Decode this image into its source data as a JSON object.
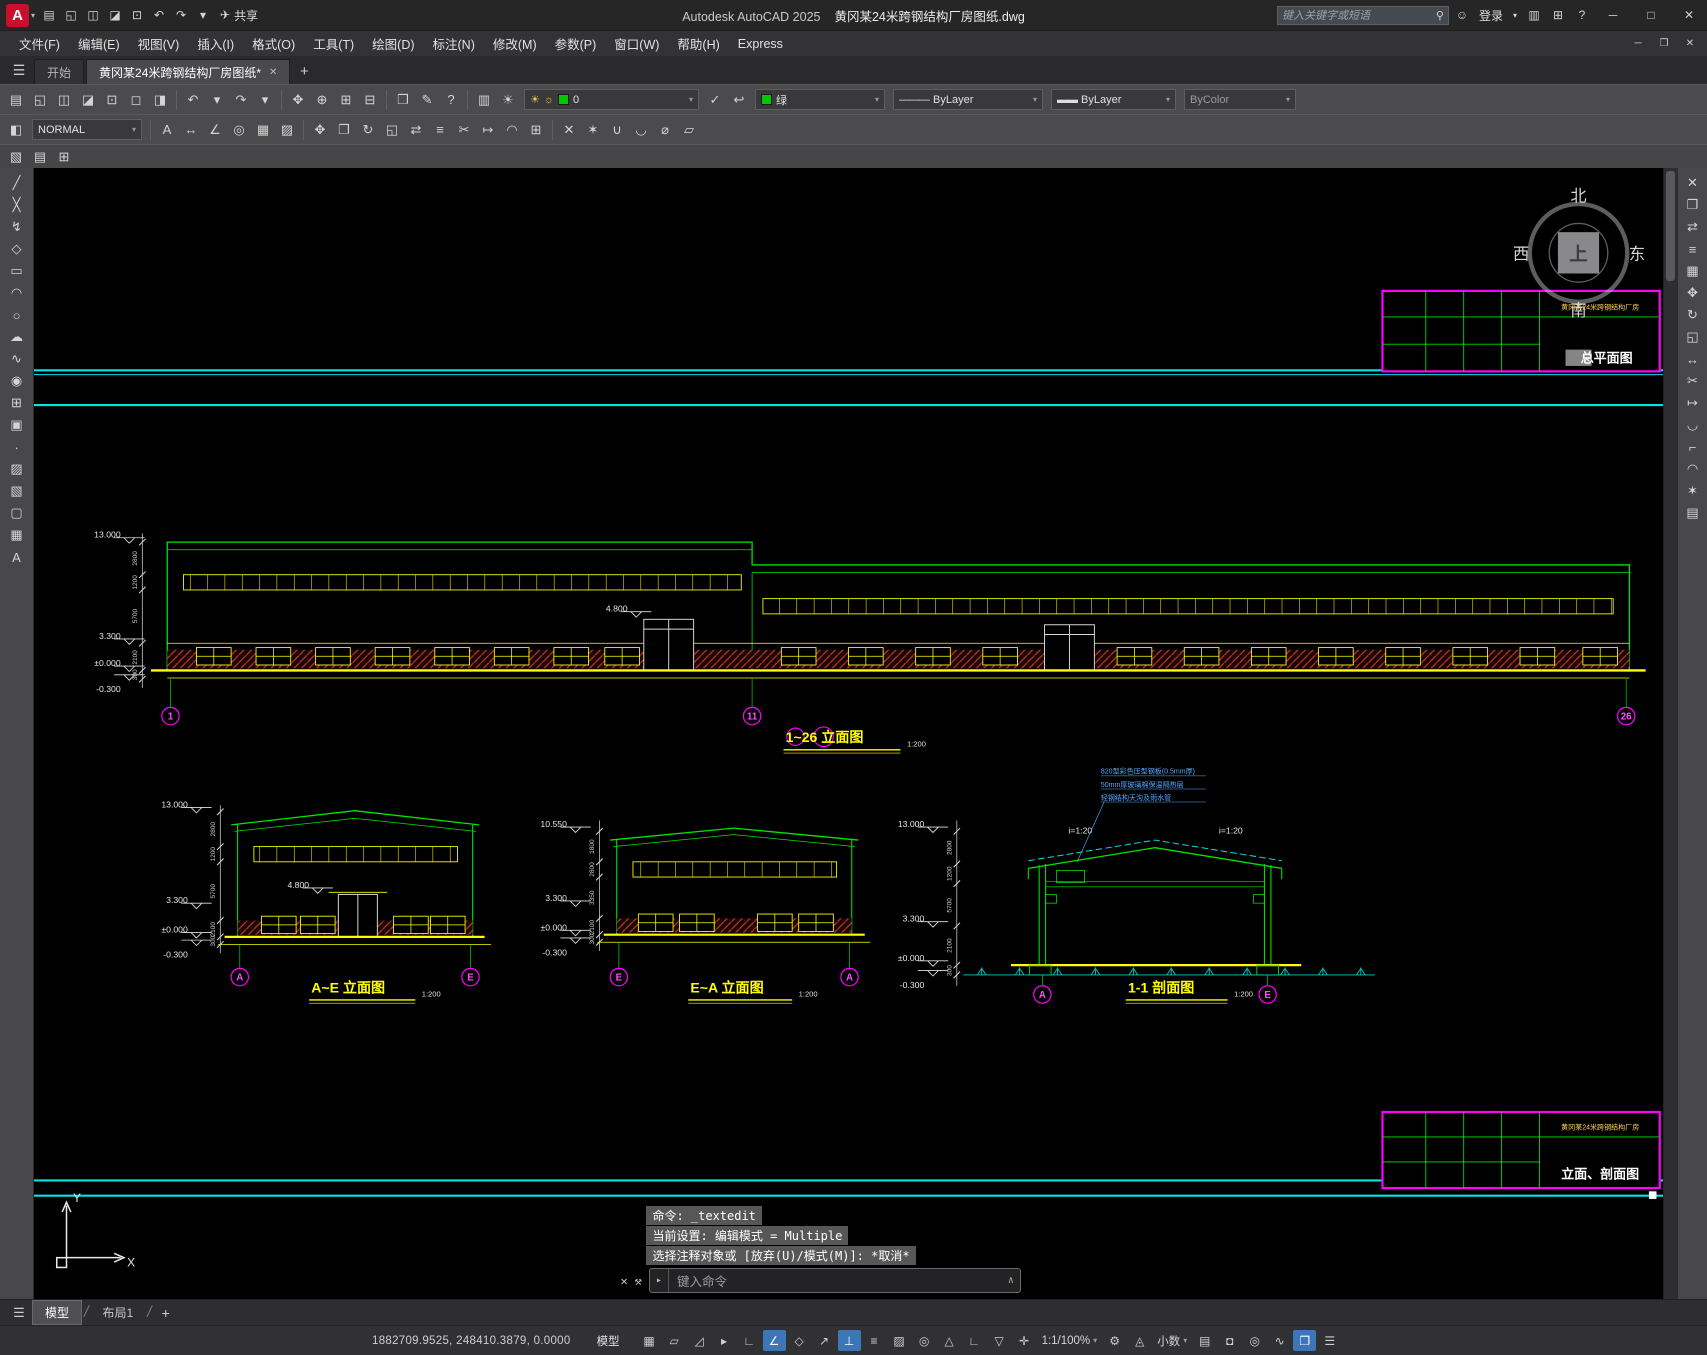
{
  "glyphs": {
    "caret": "▾",
    "hamburger": "☰",
    "close": "✕",
    "plus": "+",
    "minimize": "─",
    "maximize": "□",
    "restore": "❐",
    "search": "⚲",
    "person": "☺",
    "cart": "▥",
    "apps": "⊞",
    "question": "?",
    "share_plane": "✈",
    "slash": "/",
    "wrench": "⚒",
    "chev_up": "∧",
    "recent": "▸"
  },
  "titlebar": {
    "logo_letter": "A",
    "app_title": "Autodesk AutoCAD 2025",
    "doc_title": "黄冈某24米跨钢结构厂房图纸.dwg",
    "share": "共享",
    "search_placeholder": "键入关键字或短语",
    "login": "登录",
    "quick_icons": [
      {
        "name": "new-file-icon",
        "g": "▤"
      },
      {
        "name": "open-file-icon",
        "g": "◱"
      },
      {
        "name": "save-icon",
        "g": "◫"
      },
      {
        "name": "save-as-icon",
        "g": "◪"
      },
      {
        "name": "plot-icon",
        "g": "⊡"
      },
      {
        "name": "undo-icon",
        "g": "↶"
      },
      {
        "name": "redo-icon",
        "g": "↷"
      },
      {
        "name": "qat-caret-icon",
        "g": "▾"
      }
    ]
  },
  "menubar": {
    "items": [
      "文件(F)",
      "编辑(E)",
      "视图(V)",
      "插入(I)",
      "格式(O)",
      "工具(T)",
      "绘图(D)",
      "标注(N)",
      "修改(M)",
      "参数(P)",
      "窗口(W)",
      "帮助(H)",
      "Express"
    ]
  },
  "filetabs": {
    "start": "开始",
    "doc": "黄冈某24米跨钢结构厂房图纸*"
  },
  "toolbars": {
    "textstyle_value": "NORMAL",
    "layer_icon_on": "☀",
    "layer_icon_freeze": "☼",
    "layer_value": "0",
    "color_value": "绿",
    "linetype_preview": "———",
    "linetype_value": "ByLayer",
    "lineweight_preview": "▬▬",
    "lineweight_value": "ByLayer",
    "plotstyle_value": "ByColor",
    "tb1_g1": [
      {
        "name": "qnew-icon",
        "g": "▤"
      },
      {
        "name": "open-icon",
        "g": "◱"
      },
      {
        "name": "qsave-icon",
        "g": "◫"
      },
      {
        "name": "saveas-icon",
        "g": "◪"
      },
      {
        "name": "plot-icon",
        "g": "⊡"
      },
      {
        "name": "plot-preview-icon",
        "g": "◻"
      },
      {
        "name": "publish-icon",
        "g": "◨"
      }
    ],
    "tb1_g2": [
      {
        "name": "undo-icon",
        "g": "↶"
      },
      {
        "name": "undo-caret-icon",
        "g": "▾"
      },
      {
        "name": "redo-icon",
        "g": "↷"
      },
      {
        "name": "redo-caret-icon",
        "g": "▾"
      }
    ],
    "tb1_g3": [
      {
        "name": "pan-icon",
        "g": "✥"
      },
      {
        "name": "zoom-realtime-icon",
        "g": "⊕"
      },
      {
        "name": "zoom-window-icon",
        "g": "⊞"
      },
      {
        "name": "zoom-previous-icon",
        "g": "⊟"
      }
    ],
    "tb1_g4": [
      {
        "name": "properties-icon",
        "g": "❐"
      },
      {
        "name": "match-properties-icon",
        "g": "✎"
      },
      {
        "name": "help-icon",
        "g": "?"
      }
    ],
    "tb1_g5": [
      {
        "name": "layer-properties-icon",
        "g": "▥"
      },
      {
        "name": "layer-states-icon",
        "g": "☀"
      }
    ],
    "tb1_g6": [
      {
        "name": "make-layer-current-icon",
        "g": "✓"
      },
      {
        "name": "layer-previous-icon",
        "g": "↩"
      }
    ],
    "tb2_g1": [
      {
        "name": "draworder-icon",
        "g": "◧"
      }
    ],
    "tb2_g2": [
      {
        "name": "mtext-icon",
        "g": "A"
      },
      {
        "name": "dim-linear-icon",
        "g": "↔"
      },
      {
        "name": "dim-angular-icon",
        "g": "∠"
      },
      {
        "name": "dim-radius-icon",
        "g": "◎"
      },
      {
        "name": "table-icon",
        "g": "▦"
      },
      {
        "name": "hatch-icon",
        "g": "▨"
      }
    ],
    "tb2_g3": [
      {
        "name": "move-icon",
        "g": "✥"
      },
      {
        "name": "copy-icon",
        "g": "❐"
      },
      {
        "name": "rotate-icon",
        "g": "↻"
      },
      {
        "name": "scale-icon",
        "g": "◱"
      },
      {
        "name": "mirror-icon",
        "g": "⇄"
      },
      {
        "name": "offset-icon",
        "g": "≡"
      },
      {
        "name": "trim-icon",
        "g": "✂"
      },
      {
        "name": "extend-icon",
        "g": "↦"
      },
      {
        "name": "fillet-icon",
        "g": "◠"
      },
      {
        "name": "array-icon",
        "g": "⊞"
      }
    ],
    "tb2_g4": [
      {
        "name": "erase-icon",
        "g": "✕"
      },
      {
        "name": "explode-icon",
        "g": "✶"
      },
      {
        "name": "join-icon",
        "g": "∪"
      },
      {
        "name": "break-icon",
        "g": "◡"
      },
      {
        "name": "measure-icon",
        "g": "⌀"
      },
      {
        "name": "area-icon",
        "g": "▱"
      }
    ],
    "tb3_g1": [
      {
        "name": "group-icon",
        "g": "▧"
      },
      {
        "name": "ungroup-icon",
        "g": "▤"
      },
      {
        "name": "group-manager-icon",
        "g": "⊞"
      }
    ]
  },
  "tools": {
    "left": [
      {
        "name": "line-icon",
        "g": "╱"
      },
      {
        "name": "construction-line-icon",
        "g": "╳"
      },
      {
        "name": "polyline-icon",
        "g": "↯"
      },
      {
        "name": "polygon-icon",
        "g": "◇"
      },
      {
        "name": "rectangle-icon",
        "g": "▭"
      },
      {
        "name": "arc-icon",
        "g": "◠"
      },
      {
        "name": "circle-icon",
        "g": "○"
      },
      {
        "name": "revision-cloud-icon",
        "g": "☁"
      },
      {
        "name": "spline-icon",
        "g": "∿"
      },
      {
        "name": "ellipse-icon",
        "g": "◉"
      },
      {
        "name": "insert-block-icon",
        "g": "⊞"
      },
      {
        "name": "create-block-icon",
        "g": "▣"
      },
      {
        "name": "point-icon",
        "g": "∙"
      },
      {
        "name": "hatch-icon",
        "g": "▨"
      },
      {
        "name": "gradient-icon",
        "g": "▧"
      },
      {
        "name": "region-icon",
        "g": "▢"
      },
      {
        "name": "table-icon",
        "g": "▦"
      },
      {
        "name": "mtext-icon",
        "g": "A"
      }
    ],
    "right": [
      {
        "name": "erase-icon",
        "g": "✕"
      },
      {
        "name": "copy-icon",
        "g": "❐"
      },
      {
        "name": "mirror-icon",
        "g": "⇄"
      },
      {
        "name": "offset-icon",
        "g": "≡"
      },
      {
        "name": "array-icon",
        "g": "▦"
      },
      {
        "name": "move-icon",
        "g": "✥"
      },
      {
        "name": "rotate-icon",
        "g": "↻"
      },
      {
        "name": "scale-icon",
        "g": "◱"
      },
      {
        "name": "stretch-icon",
        "g": "↔"
      },
      {
        "name": "trim-icon",
        "g": "✂"
      },
      {
        "name": "extend-icon",
        "g": "↦"
      },
      {
        "name": "break-icon",
        "g": "◡"
      },
      {
        "name": "chamfer-icon",
        "g": "⌐"
      },
      {
        "name": "fillet-icon",
        "g": "◠"
      },
      {
        "name": "explode-icon",
        "g": "✶"
      },
      {
        "name": "properties-icon",
        "g": "▤"
      }
    ]
  },
  "canvas": {
    "compass": {
      "north": "北",
      "south": "南",
      "east": "东",
      "west": "西",
      "up": "上"
    },
    "titleblock_top": {
      "project": "黄冈某24米跨钢结构厂房",
      "sheet": "总平面图"
    },
    "titleblock_bottom": {
      "project": "黄冈某24米跨钢结构厂房",
      "sheet": "立面、剖面图"
    },
    "ucs": {
      "x_label": "X",
      "y_label": "Y"
    },
    "elev_main": {
      "title": "1~26 立面图",
      "scale": "1:200",
      "levels": {
        "top": "13.000",
        "mid": "3.300",
        "zero": "±0.000",
        "below": "-0.300",
        "door": "4.800"
      },
      "dims": [
        "2800",
        "1200",
        "5700",
        "2100",
        "300"
      ],
      "bubbles": [
        "1",
        "11",
        "26"
      ]
    },
    "elev_ae": {
      "title": "A~E 立面图",
      "scale": "1:200",
      "levels": {
        "top": "13.000",
        "mid": "3.300",
        "zero": "±0.000",
        "below": "-0.300",
        "door": "4.800"
      },
      "dims": [
        "2800",
        "1200",
        "5700",
        "2100",
        "300"
      ],
      "bubbles": [
        "A",
        "E"
      ]
    },
    "elev_ea": {
      "title": "E~A 立面图",
      "scale": "1:200",
      "levels": {
        "top": "10.550",
        "mid": "3.300",
        "zero": "±0.000",
        "below": "-0.300"
      },
      "dims": [
        "1800",
        "2800",
        "3350",
        "2100",
        "300"
      ],
      "bubbles": [
        "E",
        "A"
      ]
    },
    "section": {
      "title": "1-1 剖面图",
      "scale": "1:200",
      "levels": {
        "top": "13.000",
        "mid": "3.300",
        "zero": "±0.000",
        "below": "-0.300"
      },
      "dims": [
        "2800",
        "1200",
        "5700",
        "2100",
        "300"
      ],
      "bubbles": [
        "A",
        "E"
      ],
      "slope_left": "i=1:20",
      "slope_right": "i=1:20",
      "notes": [
        "820型彩色压型钢板(0.5mm厚)",
        "50mm厚玻璃棉保温隔热层",
        "轻钢结构天沟及雨水管"
      ]
    }
  },
  "command": {
    "history": [
      "命令: _textedit",
      "当前设置: 编辑模式 = Multiple",
      "选择注释对象或 [放弃(U)/模式(M)]: *取消*"
    ],
    "placeholder": "键入命令"
  },
  "layouttabs": {
    "model": "模型",
    "layout1": "布局1",
    "add": "+"
  },
  "statusbar": {
    "coords": "1882709.9525, 248410.3879, 0.0000",
    "model": "模型",
    "scale": "1:1/100%",
    "units": "小数",
    "icons_a": [
      {
        "name": "grid-icon",
        "g": "▦"
      },
      {
        "name": "snap-icon",
        "g": "▱"
      },
      {
        "name": "infer-constraints-icon",
        "g": "◿"
      },
      {
        "name": "dynamic-input-icon",
        "g": "▸"
      },
      {
        "name": "ortho-icon",
        "g": "∟"
      },
      {
        "name": "polar-tracking-icon",
        "g": "∠",
        "cls": "active"
      },
      {
        "name": "isometric-icon",
        "g": "◇"
      },
      {
        "name": "object-snap-tracking-icon",
        "g": "↗"
      },
      {
        "name": "object-snap-icon",
        "g": "⊥",
        "cls": "active"
      },
      {
        "name": "lineweight-display-icon",
        "g": "≡"
      },
      {
        "name": "transparency-icon",
        "g": "▨"
      },
      {
        "name": "selection-cycling-icon",
        "g": "◎"
      },
      {
        "name": "osnap-3d-icon",
        "g": "△"
      },
      {
        "name": "dynamic-ucs-icon",
        "g": "∟"
      },
      {
        "name": "selection-filter-icon",
        "g": "▽"
      },
      {
        "name": "gizmo-icon",
        "g": "✛"
      }
    ],
    "icons_b": [
      {
        "name": "workspace-icon",
        "g": "⚙"
      },
      {
        "name": "annotation-monitor-icon",
        "g": "◬"
      }
    ],
    "icons_c": [
      {
        "name": "quick-properties-icon",
        "g": "▤"
      },
      {
        "name": "lock-ui-icon",
        "g": "◘"
      },
      {
        "name": "isolate-objects-icon",
        "g": "◎"
      },
      {
        "name": "graphics-performance-icon",
        "g": "∿"
      },
      {
        "name": "clean-screen-icon",
        "g": "❐",
        "cls": "active"
      },
      {
        "name": "customize-icon",
        "g": "☰"
      }
    ]
  }
}
